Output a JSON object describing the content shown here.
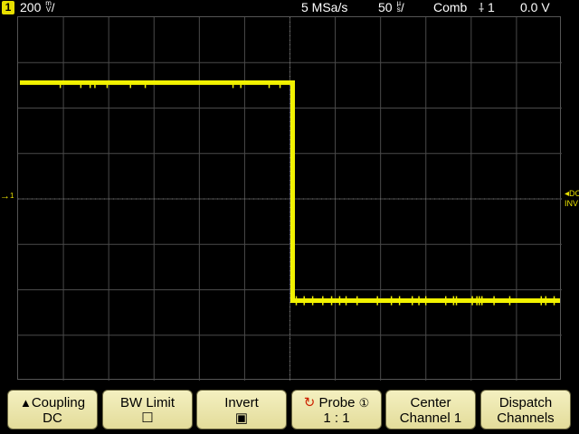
{
  "status_bar": {
    "channel_number": "1",
    "vertical_scale": "200",
    "vertical_unit_top": "m",
    "vertical_unit_bottom": "V",
    "sample_rate": "5 MSa/s",
    "timebase": "50",
    "timebase_unit_top": "µ",
    "timebase_unit_bottom": "s",
    "trigger_mode": "Comb",
    "trigger_icon": "trigger-edge-icon",
    "trigger_source": "1",
    "trigger_level": "0.0 V"
  },
  "markers": {
    "ch1_ground": "1",
    "right_coupling": "DC",
    "right_invert": "INV"
  },
  "colors": {
    "trace": "#f2f200",
    "grid": "#4a4a4a",
    "softkey_bg": "#ece6ae",
    "trigger_marker": "#ff7a00"
  },
  "trace": {
    "description_levels": "square step high→low",
    "high_fraction_of_screen": 0.18,
    "low_fraction_of_screen": 0.78,
    "step_fraction_of_screen": 0.5
  },
  "softkeys": [
    {
      "line1": "Coupling",
      "line2": "DC",
      "prefix_icon": "up-triangle-icon"
    },
    {
      "line1": "BW Limit",
      "line2": "☐"
    },
    {
      "line1": "Invert",
      "line2": "▣"
    },
    {
      "line1": "Probe",
      "line2": "1 : 1",
      "prefix_icon": "rotate-knob-icon",
      "suffix": "①"
    },
    {
      "line1": "Center",
      "line2": "Channel 1"
    },
    {
      "line1": "Dispatch",
      "line2": "Channels"
    }
  ]
}
